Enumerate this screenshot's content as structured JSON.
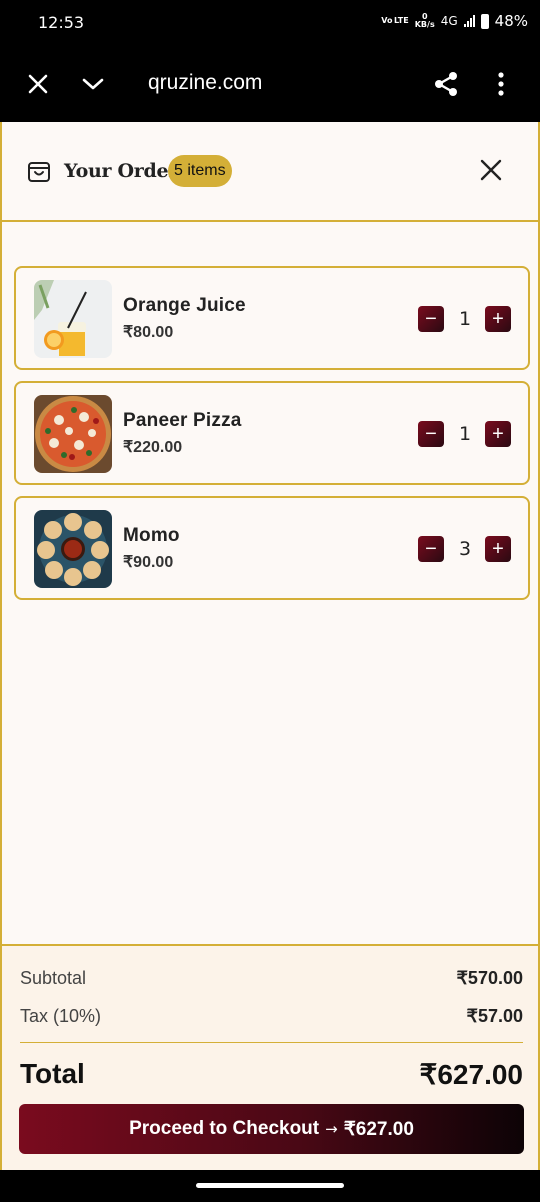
{
  "status_bar": {
    "time": "12:53",
    "volte": "Vo LTE",
    "speed_top": "0",
    "speed_bottom": "KB/s",
    "network": "4G",
    "battery": "48%"
  },
  "browser": {
    "url": "qruzine.com",
    "icons": [
      "close-icon",
      "chevron-down-icon",
      "share-icon",
      "more-vert-icon"
    ]
  },
  "order": {
    "title": "Your Order",
    "badge": "5 items",
    "items": [
      {
        "name": "Orange Juice",
        "price": "₹80.00",
        "qty": "1",
        "image": "orange-juice-photo"
      },
      {
        "name": "Paneer Pizza",
        "price": "₹220.00",
        "qty": "1",
        "image": "paneer-pizza-photo"
      },
      {
        "name": "Momo",
        "price": "₹90.00",
        "qty": "3",
        "image": "momo-photo"
      }
    ],
    "minus_symbol": "−",
    "plus_symbol": "+"
  },
  "summary": {
    "subtotal_label": "Subtotal",
    "subtotal_value": "₹570.00",
    "tax_label": "Tax (10%)",
    "tax_value": "₹57.00",
    "total_label": "Total",
    "total_value": "₹627.00",
    "checkout_label": "Proceed to Checkout",
    "checkout_arrow": "→",
    "checkout_amount": "₹627.00"
  },
  "colors": {
    "accent_gold": "#d4af37",
    "button_maroon": "#7a0b1e",
    "page_bg": "#fdf9f6",
    "summary_bg": "#fcf3e9"
  }
}
